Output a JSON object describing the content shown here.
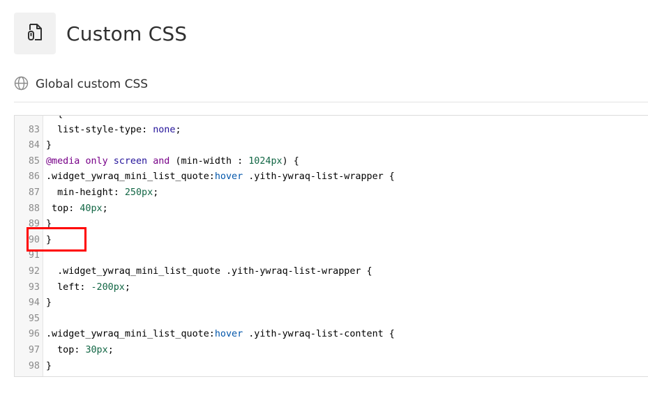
{
  "header": {
    "title": "Custom CSS",
    "icon": "css-file-icon"
  },
  "section": {
    "title": "Global custom CSS",
    "icon": "globe-icon"
  },
  "editor": {
    "lines": [
      {
        "num": "",
        "tokens": [
          {
            "t": "  {",
            "c": "plain"
          }
        ]
      },
      {
        "num": "83",
        "tokens": [
          {
            "t": "  list-style-type",
            "c": "prop"
          },
          {
            "t": ": ",
            "c": "plain"
          },
          {
            "t": "none",
            "c": "val"
          },
          {
            "t": ";",
            "c": "plain"
          }
        ]
      },
      {
        "num": "84",
        "tokens": [
          {
            "t": "}",
            "c": "plain"
          }
        ]
      },
      {
        "num": "85",
        "tokens": [
          {
            "t": "@media",
            "c": "kw"
          },
          {
            "t": " ",
            "c": "plain"
          },
          {
            "t": "only",
            "c": "kw"
          },
          {
            "t": " ",
            "c": "plain"
          },
          {
            "t": "screen",
            "c": "val"
          },
          {
            "t": " ",
            "c": "plain"
          },
          {
            "t": "and",
            "c": "kw"
          },
          {
            "t": " (min-width : ",
            "c": "plain"
          },
          {
            "t": "1024px",
            "c": "num"
          },
          {
            "t": ") {",
            "c": "plain"
          }
        ]
      },
      {
        "num": "86",
        "tokens": [
          {
            "t": ".widget_ywraq_mini_list_quote:",
            "c": "plain"
          },
          {
            "t": "hover",
            "c": "qual"
          },
          {
            "t": " .yith-ywraq-list-wrapper {",
            "c": "plain"
          }
        ]
      },
      {
        "num": "87",
        "tokens": [
          {
            "t": "  min-height",
            "c": "prop"
          },
          {
            "t": ": ",
            "c": "plain"
          },
          {
            "t": "250px",
            "c": "num"
          },
          {
            "t": ";",
            "c": "plain"
          }
        ]
      },
      {
        "num": "88",
        "tokens": [
          {
            "t": " top",
            "c": "prop"
          },
          {
            "t": ": ",
            "c": "plain"
          },
          {
            "t": "40px",
            "c": "num"
          },
          {
            "t": ";",
            "c": "plain"
          }
        ]
      },
      {
        "num": "89",
        "tokens": [
          {
            "t": "}",
            "c": "plain"
          }
        ]
      },
      {
        "num": "90",
        "tokens": [
          {
            "t": "}",
            "c": "plain"
          }
        ]
      },
      {
        "num": "91",
        "tokens": []
      },
      {
        "num": "92",
        "tokens": [
          {
            "t": "  .widget_ywraq_mini_list_quote .yith-ywraq-list-wrapper {",
            "c": "plain"
          }
        ]
      },
      {
        "num": "93",
        "tokens": [
          {
            "t": "  left",
            "c": "prop"
          },
          {
            "t": ": ",
            "c": "plain"
          },
          {
            "t": "-200px",
            "c": "num"
          },
          {
            "t": ";",
            "c": "plain"
          }
        ]
      },
      {
        "num": "94",
        "tokens": [
          {
            "t": "}",
            "c": "plain"
          }
        ]
      },
      {
        "num": "95",
        "tokens": []
      },
      {
        "num": "96",
        "tokens": [
          {
            "t": ".widget_ywraq_mini_list_quote:",
            "c": "plain"
          },
          {
            "t": "hover",
            "c": "qual"
          },
          {
            "t": " .yith-ywraq-list-content {",
            "c": "plain"
          }
        ]
      },
      {
        "num": "97",
        "tokens": [
          {
            "t": "  top",
            "c": "prop"
          },
          {
            "t": ": ",
            "c": "plain"
          },
          {
            "t": "30px",
            "c": "num"
          },
          {
            "t": ";",
            "c": "plain"
          }
        ]
      },
      {
        "num": "98",
        "tokens": [
          {
            "t": "}",
            "c": "plain"
          }
        ]
      }
    ]
  },
  "colors": {
    "highlight": "#ff0000",
    "keyword": "#770088",
    "value": "#221199",
    "number": "#116644",
    "qualifier": "#0055aa"
  }
}
